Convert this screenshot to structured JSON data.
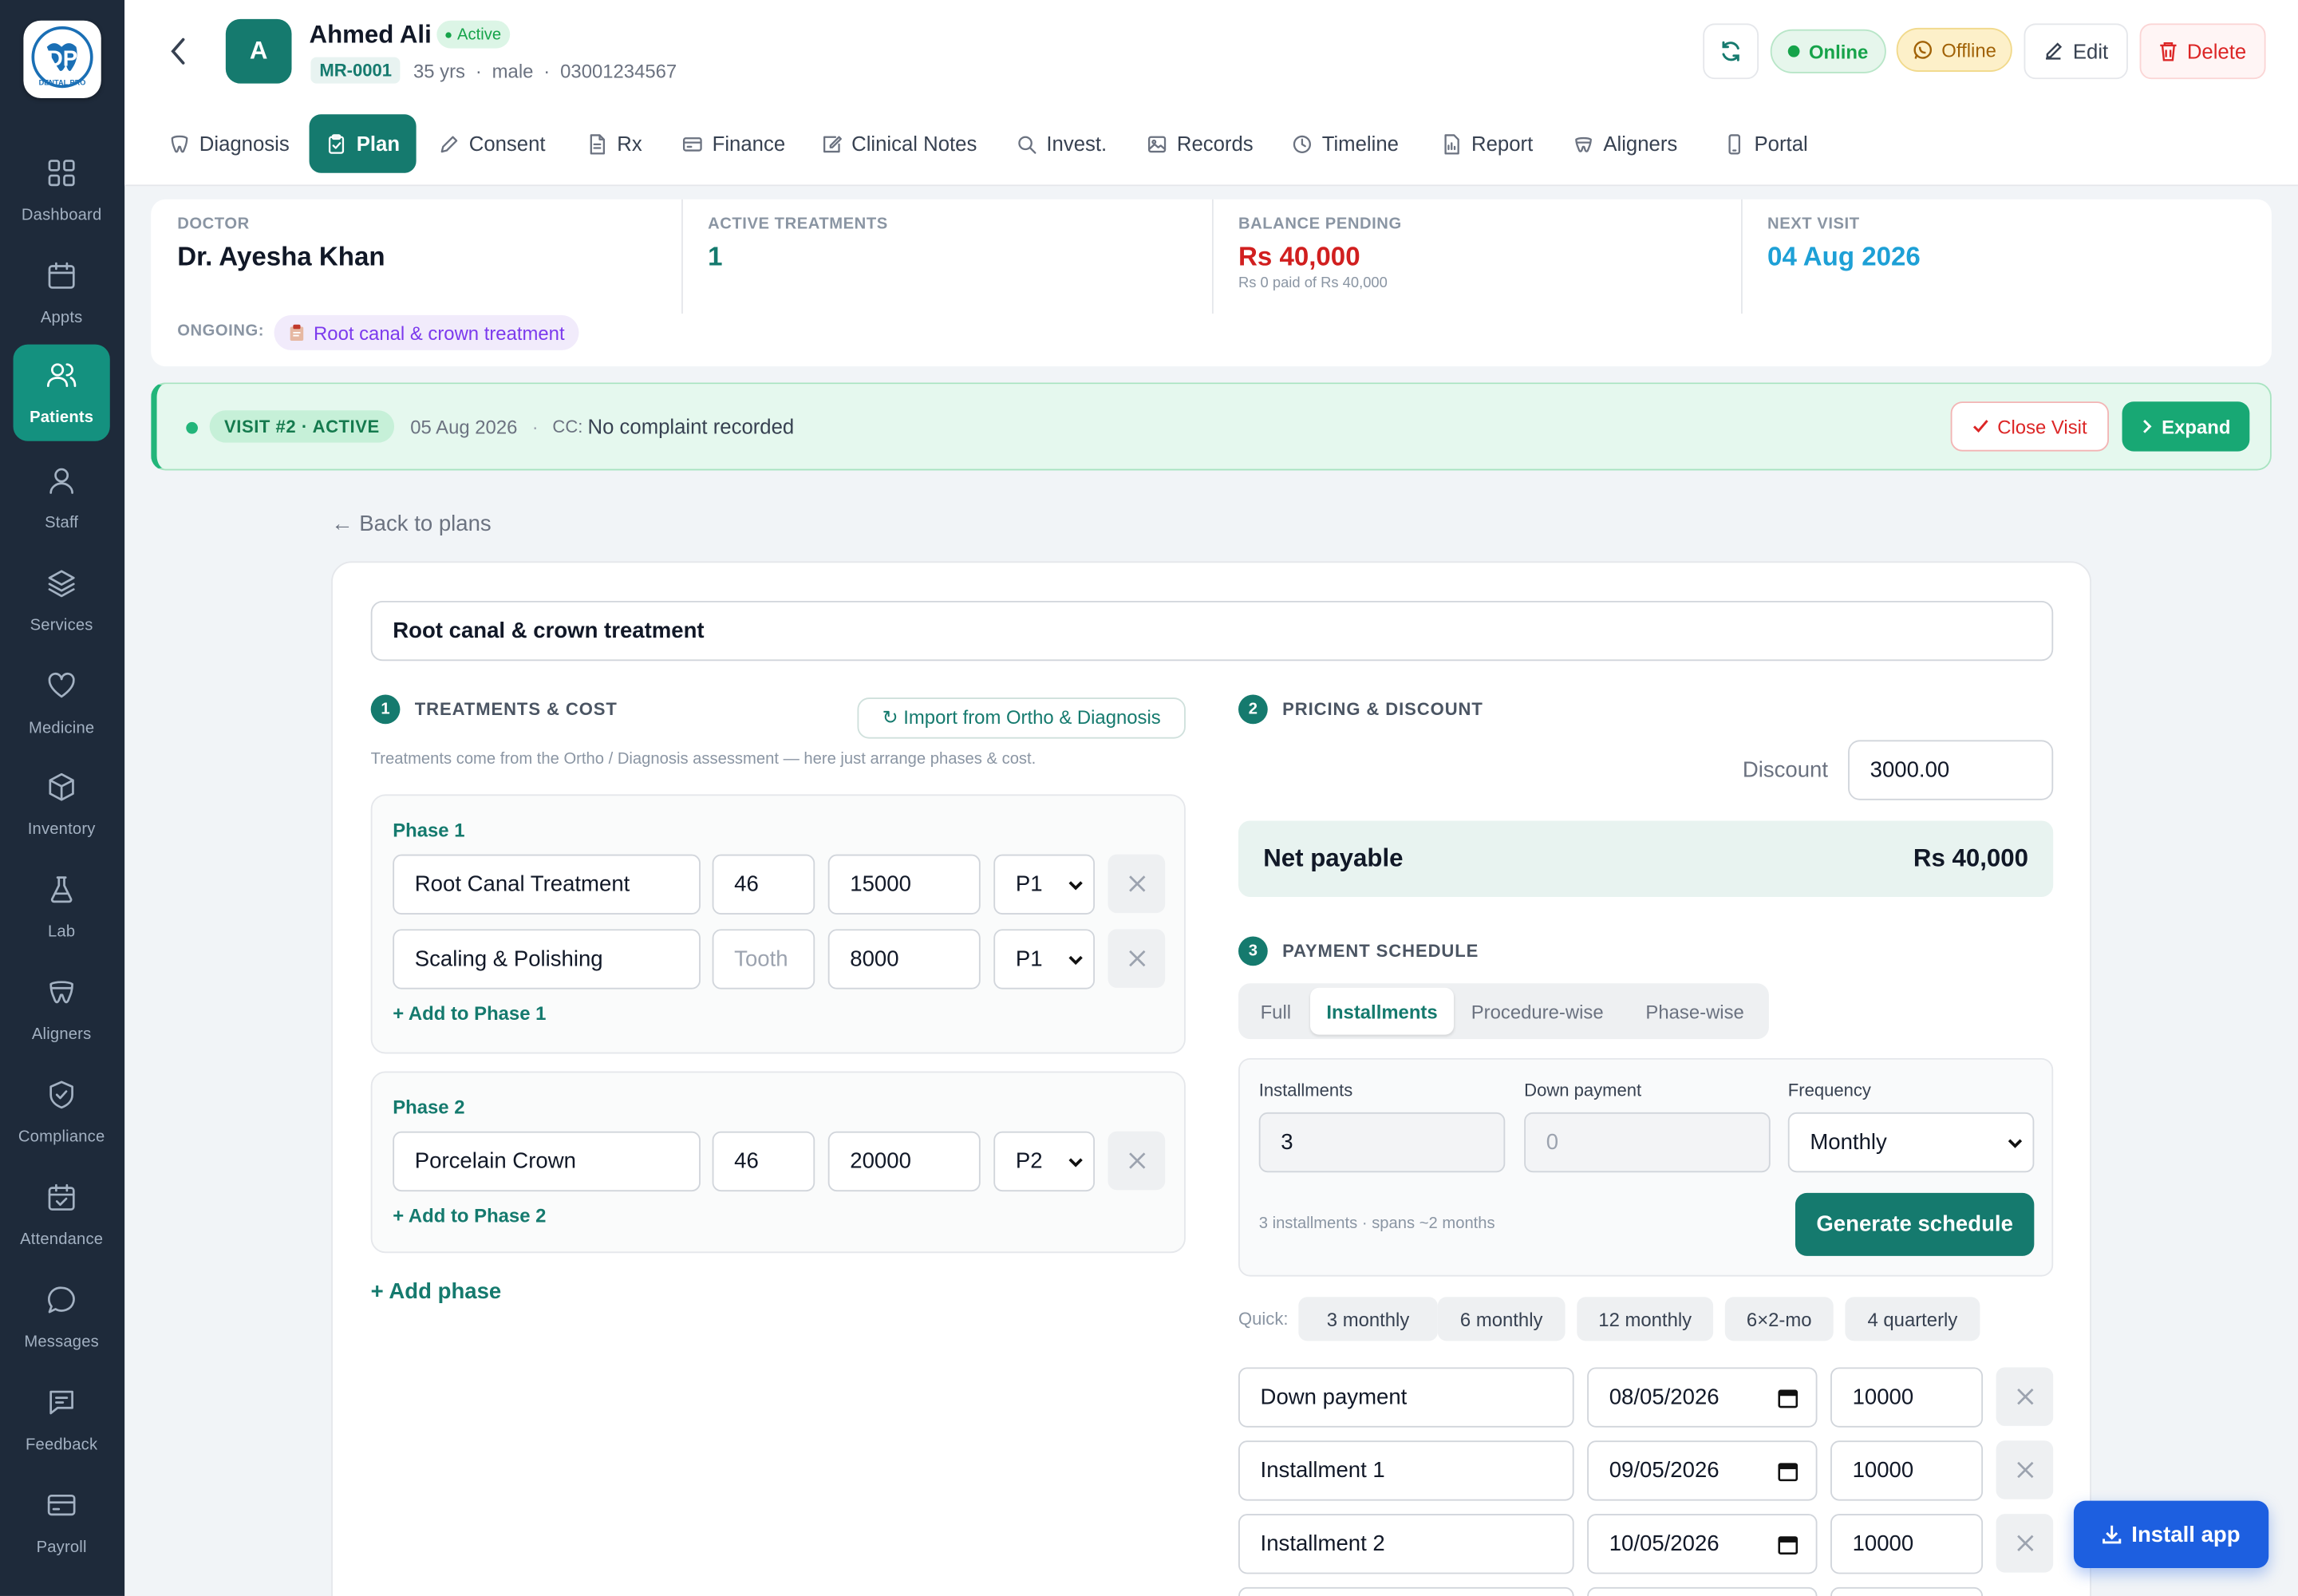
{
  "sidebar": {
    "items": [
      {
        "label": "Dashboard",
        "icon": "grid-icon"
      },
      {
        "label": "Appts",
        "icon": "calendar-icon"
      },
      {
        "label": "Patients",
        "icon": "users-icon",
        "active": true
      },
      {
        "label": "Staff",
        "icon": "user-icon"
      },
      {
        "label": "Services",
        "icon": "layers-icon"
      },
      {
        "label": "Medicine",
        "icon": "heart-icon"
      },
      {
        "label": "Inventory",
        "icon": "box-icon"
      },
      {
        "label": "Lab",
        "icon": "flask-icon"
      },
      {
        "label": "Aligners",
        "icon": "tooth-aligner-icon"
      },
      {
        "label": "Compliance",
        "icon": "shield-check-icon"
      },
      {
        "label": "Attendance",
        "icon": "calendar-check-icon"
      },
      {
        "label": "Messages",
        "icon": "message-icon"
      },
      {
        "label": "Feedback",
        "icon": "feedback-icon"
      },
      {
        "label": "Payroll",
        "icon": "credit-card-icon"
      }
    ]
  },
  "patient": {
    "avatar": "A",
    "name": "Ahmed Ali",
    "status": "Active",
    "mr": "MR-0001",
    "age": "35 yrs",
    "sep": "·",
    "gender": "male",
    "phone": "03001234567"
  },
  "header": {
    "online": "Online",
    "offline": "Offline",
    "edit": "Edit",
    "delete": "Delete"
  },
  "tabs": [
    "Diagnosis",
    "Plan",
    "Consent",
    "Rx",
    "Finance",
    "Clinical Notes",
    "Invest.",
    "Records",
    "Timeline",
    "Report",
    "Aligners",
    "Portal"
  ],
  "summary": {
    "doctor_label": "DOCTOR",
    "doctor": "Dr. Ayesha Khan",
    "active_label": "ACTIVE TREATMENTS",
    "active": "1",
    "balance_label": "BALANCE PENDING",
    "balance": "Rs 40,000",
    "balance_sub": "Rs 0 paid of Rs 40,000",
    "next_label": "NEXT VISIT",
    "next": "04 Aug 2026",
    "ongoing_label": "ONGOING:",
    "ongoing": "Root canal & crown treatment"
  },
  "visit": {
    "badge": "VISIT #2 · ACTIVE",
    "date": "05 Aug 2026",
    "cc_label": "CC:",
    "cc": "No complaint recorded",
    "close": "Close Visit",
    "expand": "Expand"
  },
  "plan": {
    "back": "← Back to plans",
    "title": "Root canal & crown treatment",
    "s1_num": "1",
    "s1": "TREATMENTS & COST",
    "import": "↻ Import from Ortho & Diagnosis",
    "note": "Treatments come from the Ortho / Diagnosis assessment — here just arrange phases & cost.",
    "phases": [
      {
        "title": "Phase 1",
        "add": "+ Add to Phase 1",
        "rows": [
          {
            "name": "Root Canal Treatment",
            "tooth": "46",
            "cost": "15000",
            "phase": "P1"
          },
          {
            "name": "Scaling & Polishing",
            "tooth": "",
            "cost": "8000",
            "phase": "P1"
          }
        ]
      },
      {
        "title": "Phase 2",
        "add": "+ Add to Phase 2",
        "rows": [
          {
            "name": "Porcelain Crown",
            "tooth": "46",
            "cost": "20000",
            "phase": "P2"
          }
        ]
      }
    ],
    "tooth_placeholder": "Tooth",
    "add_phase": "+ Add phase",
    "s2_num": "2",
    "s2": "PRICING & DISCOUNT",
    "discount_label": "Discount",
    "discount": "3000.00",
    "net_label": "Net payable",
    "net": "Rs 40,000",
    "s3_num": "3",
    "s3": "PAYMENT SCHEDULE",
    "sched_tabs": [
      "Full",
      "Installments",
      "Procedure-wise",
      "Phase-wise"
    ],
    "inst_label": "Installments",
    "inst": "3",
    "down_label": "Down payment",
    "down_placeholder": "0",
    "freq_label": "Frequency",
    "freq": "Monthly",
    "inst_note": "3 installments · spans ~2 months",
    "generate": "Generate schedule",
    "quick_label": "Quick:",
    "quick": [
      "3 monthly",
      "6 monthly",
      "12 monthly",
      "6×2-mo",
      "4 quarterly"
    ],
    "schedule": [
      {
        "label": "Down payment",
        "date": "08/05/2026",
        "amount": "10000"
      },
      {
        "label": "Installment 1",
        "date": "09/05/2026",
        "amount": "10000"
      },
      {
        "label": "Installment 2",
        "date": "10/05/2026",
        "amount": "10000"
      }
    ]
  },
  "install": "Install app",
  "colors": {
    "teal": "#157a6e",
    "sidebar": "#1e2a3a",
    "red": "#d11f1f",
    "blue": "#1ea0d6"
  }
}
